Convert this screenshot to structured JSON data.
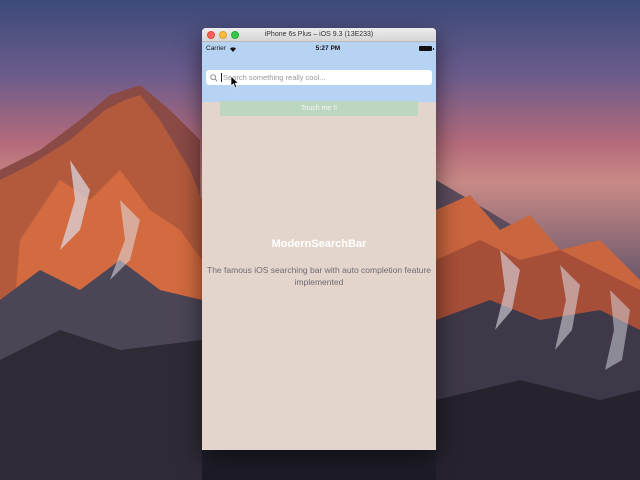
{
  "window": {
    "title": "iPhone 6s Plus – iOS 9.3 (13E233)"
  },
  "status_bar": {
    "carrier": "Carrier",
    "time": "5:27 PM"
  },
  "search": {
    "placeholder": "Search something really cool...",
    "value": "",
    "icon": "search-icon"
  },
  "main": {
    "button_label": "Touch me !!",
    "title": "ModernSearchBar",
    "description": "The famous iOS searching bar with auto completion feature implemented"
  },
  "colors": {
    "header_bg": "#b7d3f3",
    "content_bg": "#e3d5cb",
    "button_bg": "#bcd6c0"
  }
}
